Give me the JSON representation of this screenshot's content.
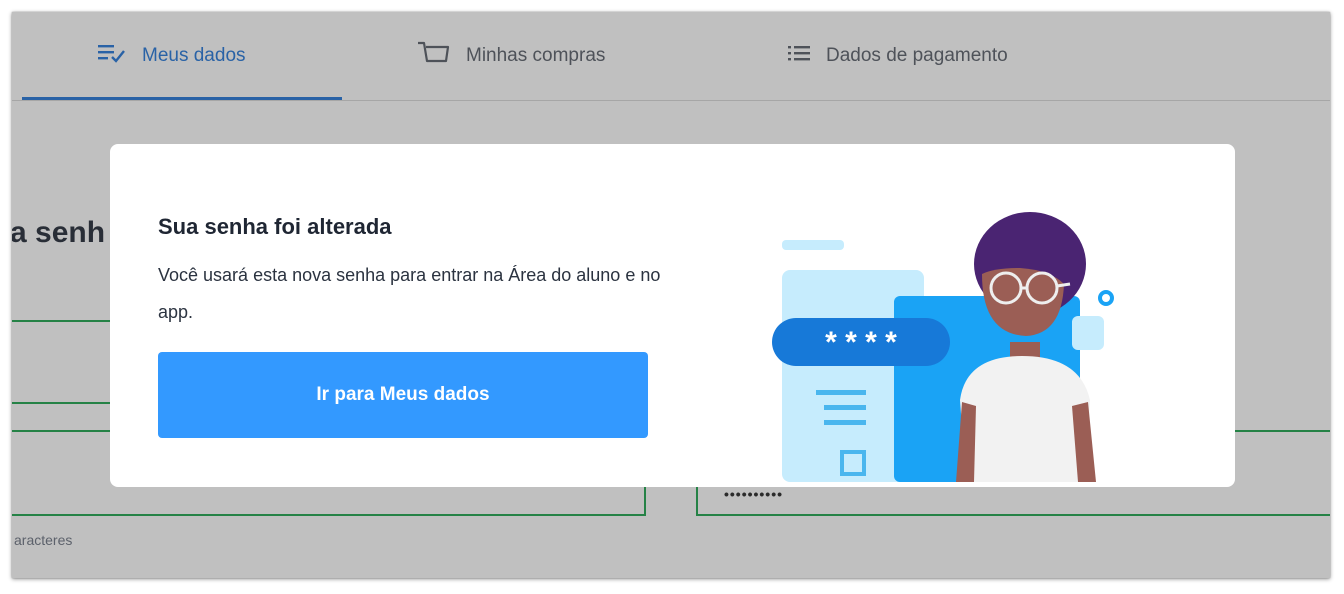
{
  "tabs": [
    {
      "label": "Meus dados",
      "icon": "edit-list-icon",
      "active": true
    },
    {
      "label": "Minhas compras",
      "icon": "cart-icon",
      "active": false
    },
    {
      "label": "Dados de pagamento",
      "icon": "list-icon",
      "active": false
    }
  ],
  "page": {
    "heading_fragment": "a senh",
    "password_mask": "••••••••••",
    "hint_fragment": "aracteres"
  },
  "modal": {
    "title": "Sua senha foi alterada",
    "message": "Você usará esta nova senha para entrar na Área do aluno e no app.",
    "button_label": "Ir para Meus dados",
    "illustration": {
      "mask_text": "* * * *",
      "icon": "password-person-illustration"
    }
  },
  "colors": {
    "accent": "#1f74d8",
    "button": "#3399ff",
    "field_border": "#18a34a",
    "hair": "#4a2472",
    "skin": "#9b5e55",
    "panel_blue": "#1aa3f5",
    "panel_light": "#c6ecfd",
    "pill_blue": "#1779d8"
  }
}
